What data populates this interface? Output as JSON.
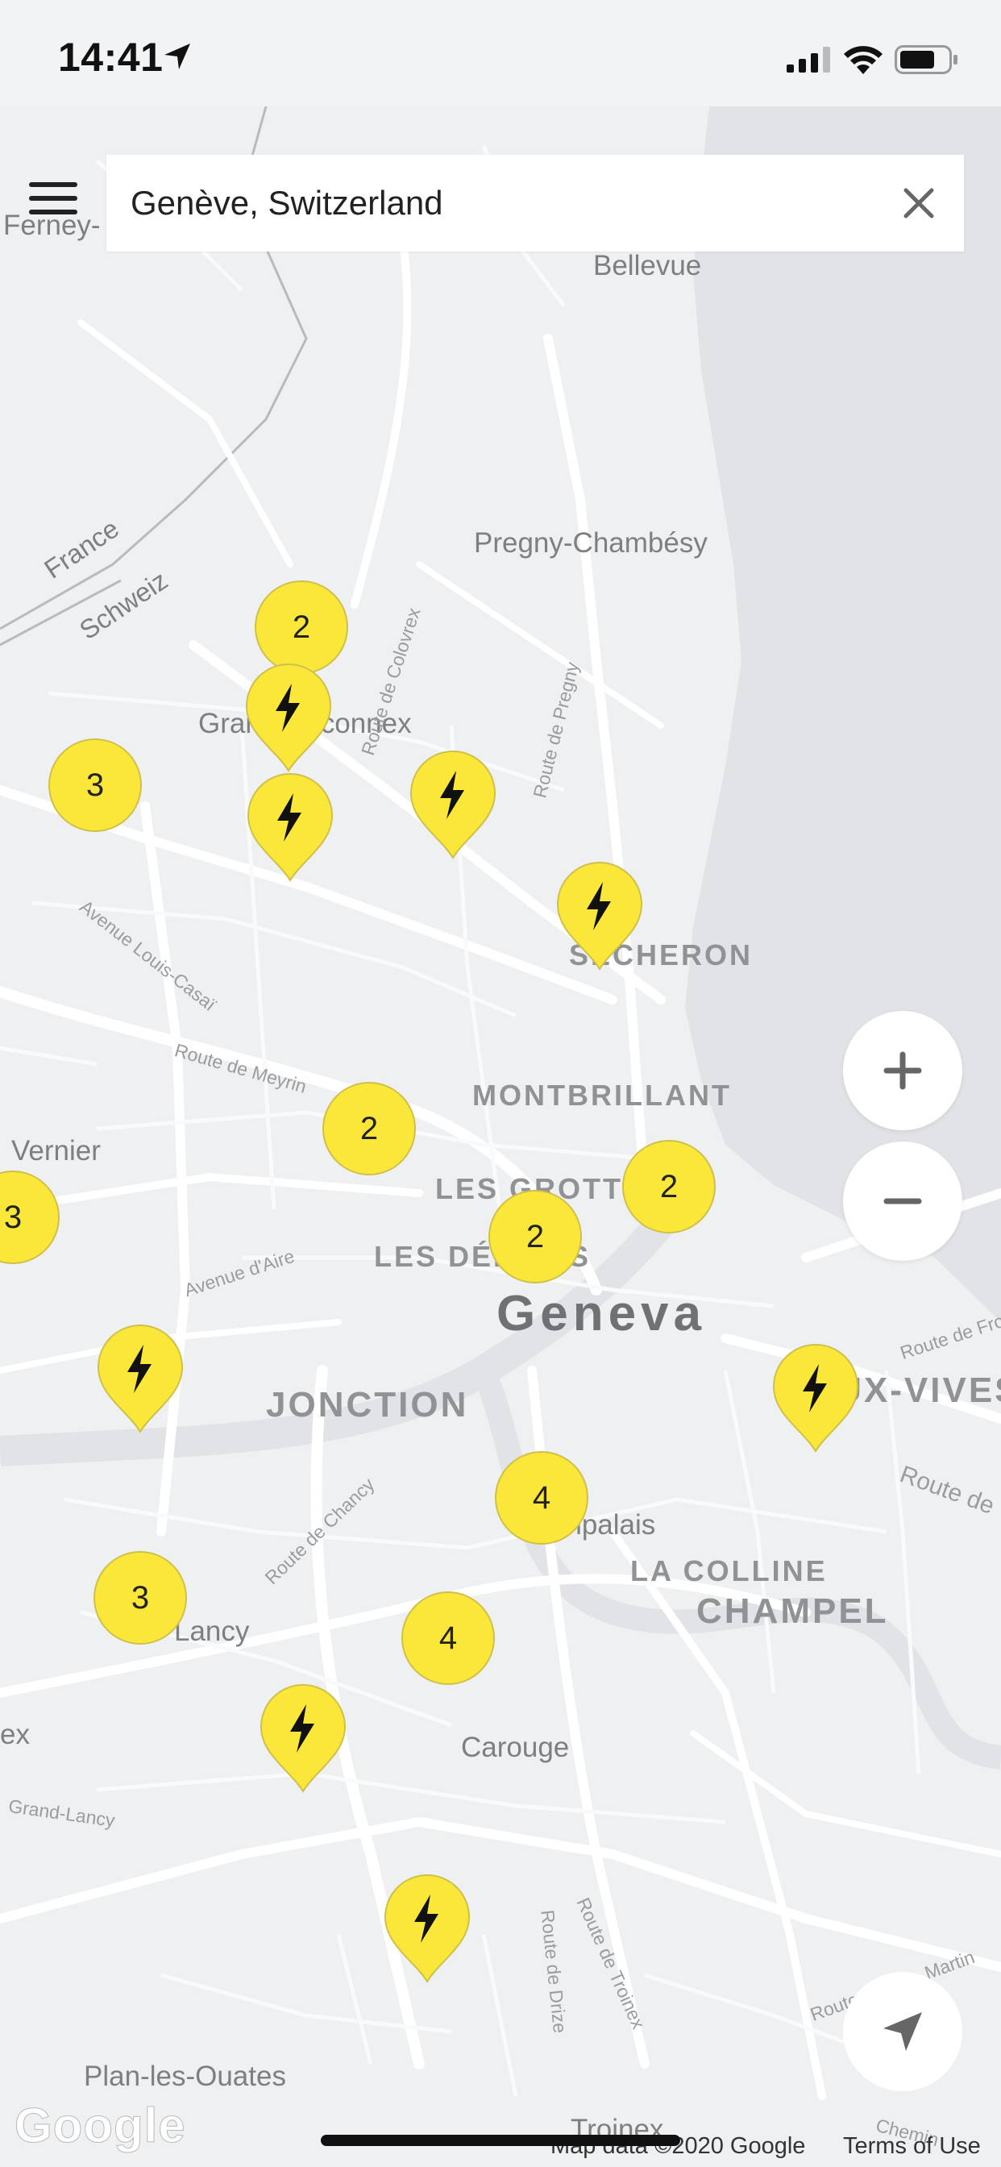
{
  "status": {
    "time": "14:41"
  },
  "search": {
    "query": "Genève, Switzerland"
  },
  "map": {
    "places": {
      "ferney": "Ferney-",
      "bellevue": "Bellevue",
      "pregny": "Pregny-Chambésy",
      "grand_saconnex": "Grand-Saconnex",
      "vernier": "Vernier",
      "carouge": "Carouge",
      "plan_les_ouates": "Plan-les-Ouates",
      "plainpalais": "Plainpalais",
      "lancy": "Lancy",
      "onex": "ex",
      "troinex": "Troinex",
      "france": "France",
      "schweiz": "Schweiz"
    },
    "districts": {
      "secheron": "SÉCHERON",
      "montbrillant": "MONTBRILLANT",
      "les_grottes": "LES GROTTES",
      "les_delices": "LES DÉLICES",
      "jonction": "JONCTION",
      "eaux_vives": "EAUX-VIVES",
      "la_colline": "LA COLLINE",
      "champel": "CHAMPEL"
    },
    "city": "Geneva",
    "roads": {
      "colovrex": "Route de Colovrex",
      "pregny": "Route de Pregny",
      "louis_casai": "Avenue Louis-Casaï",
      "meyrin": "Route de Meyrin",
      "aire": "Avenue d'Aire",
      "chancy": "Route de Chancy",
      "grand_lancy": "Grand-Lancy",
      "drize": "Route de Drize",
      "troinex": "Route de Troinex",
      "antoine_martin": "Route Antoine Martin",
      "frontenex": "Route de Front",
      "route_de": "Route de",
      "chemin": "Chemin"
    },
    "clusters": [
      "2",
      "3",
      "2",
      "2",
      "2",
      "3",
      "4",
      "3",
      "4"
    ],
    "footer": {
      "logo": "Google",
      "attribution": "Map data ©2020 Google",
      "terms": "Terms of Use"
    }
  },
  "colors": {
    "marker": "#fbe73a",
    "marker_border": "#cfc049",
    "map_bg": "#eef0f2"
  }
}
